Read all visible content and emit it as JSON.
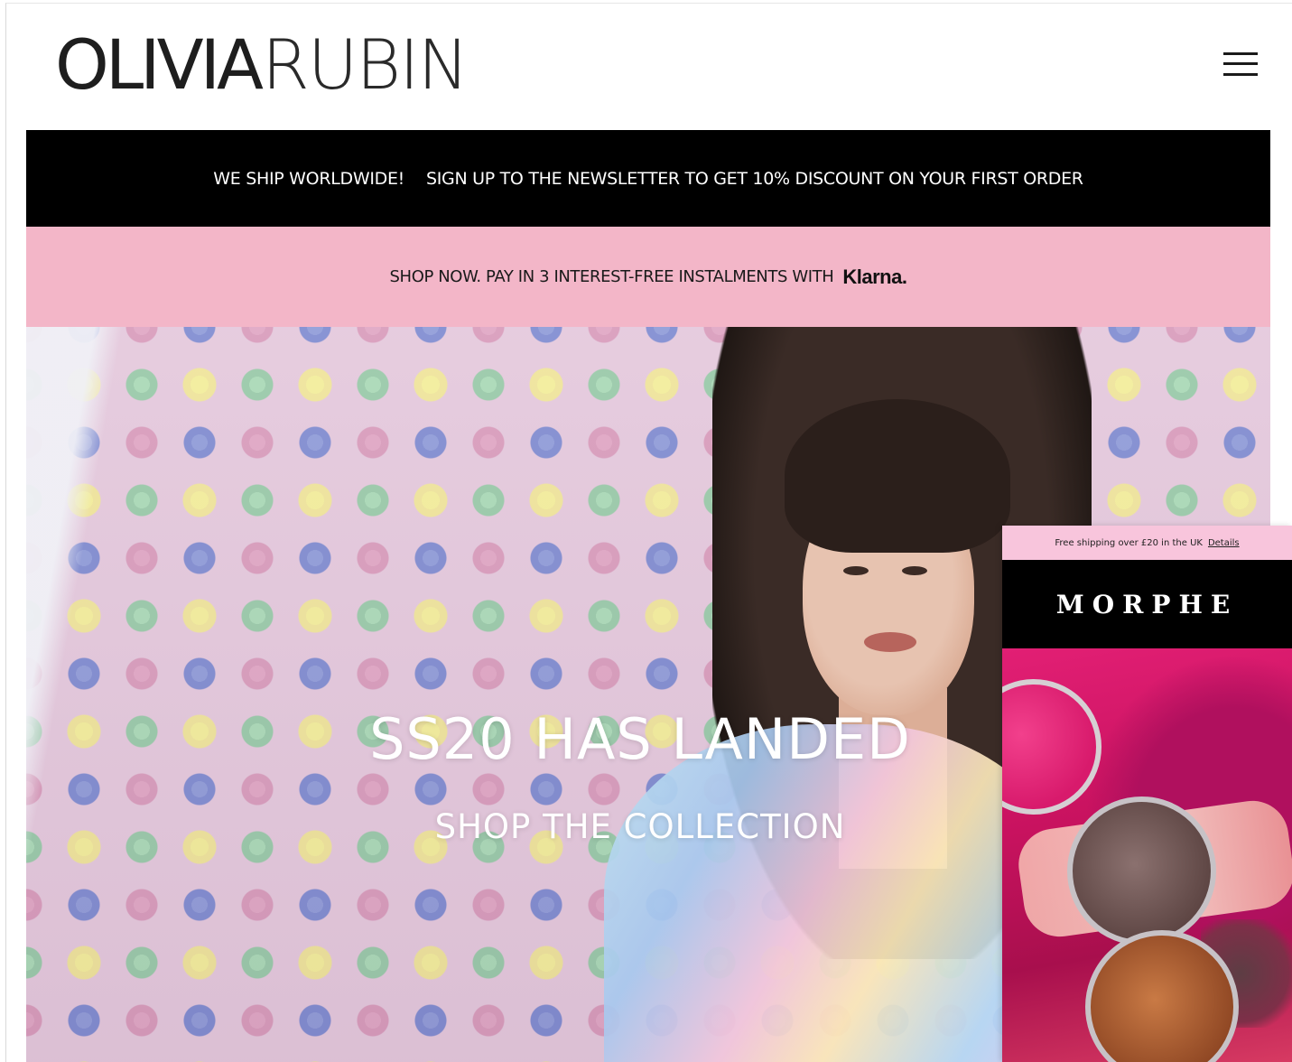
{
  "header": {
    "logo_part1": "OLIVIA",
    "logo_part2": "RUBIN",
    "menu_icon": "hamburger-menu-icon"
  },
  "announcement": {
    "shipping": "WE SHIP WORLDWIDE!",
    "newsletter": "SIGN UP TO THE NEWSLETTER TO GET 10% DISCOUNT ON YOUR FIRST ORDER",
    "background": "#000000"
  },
  "klarna": {
    "text": "SHOP NOW. PAY IN 3 INTEREST-FREE INSTALMENTS WITH",
    "logo": "Klarna.",
    "background": "#f3b6c8"
  },
  "hero": {
    "title": "SS20 HAS LANDED",
    "cta": "SHOP THE COLLECTION"
  },
  "ad": {
    "shipping_text": "Free shipping over £20 in the UK",
    "details_link": "Details",
    "brand": "MORPHE",
    "accent": "#d5146a"
  }
}
